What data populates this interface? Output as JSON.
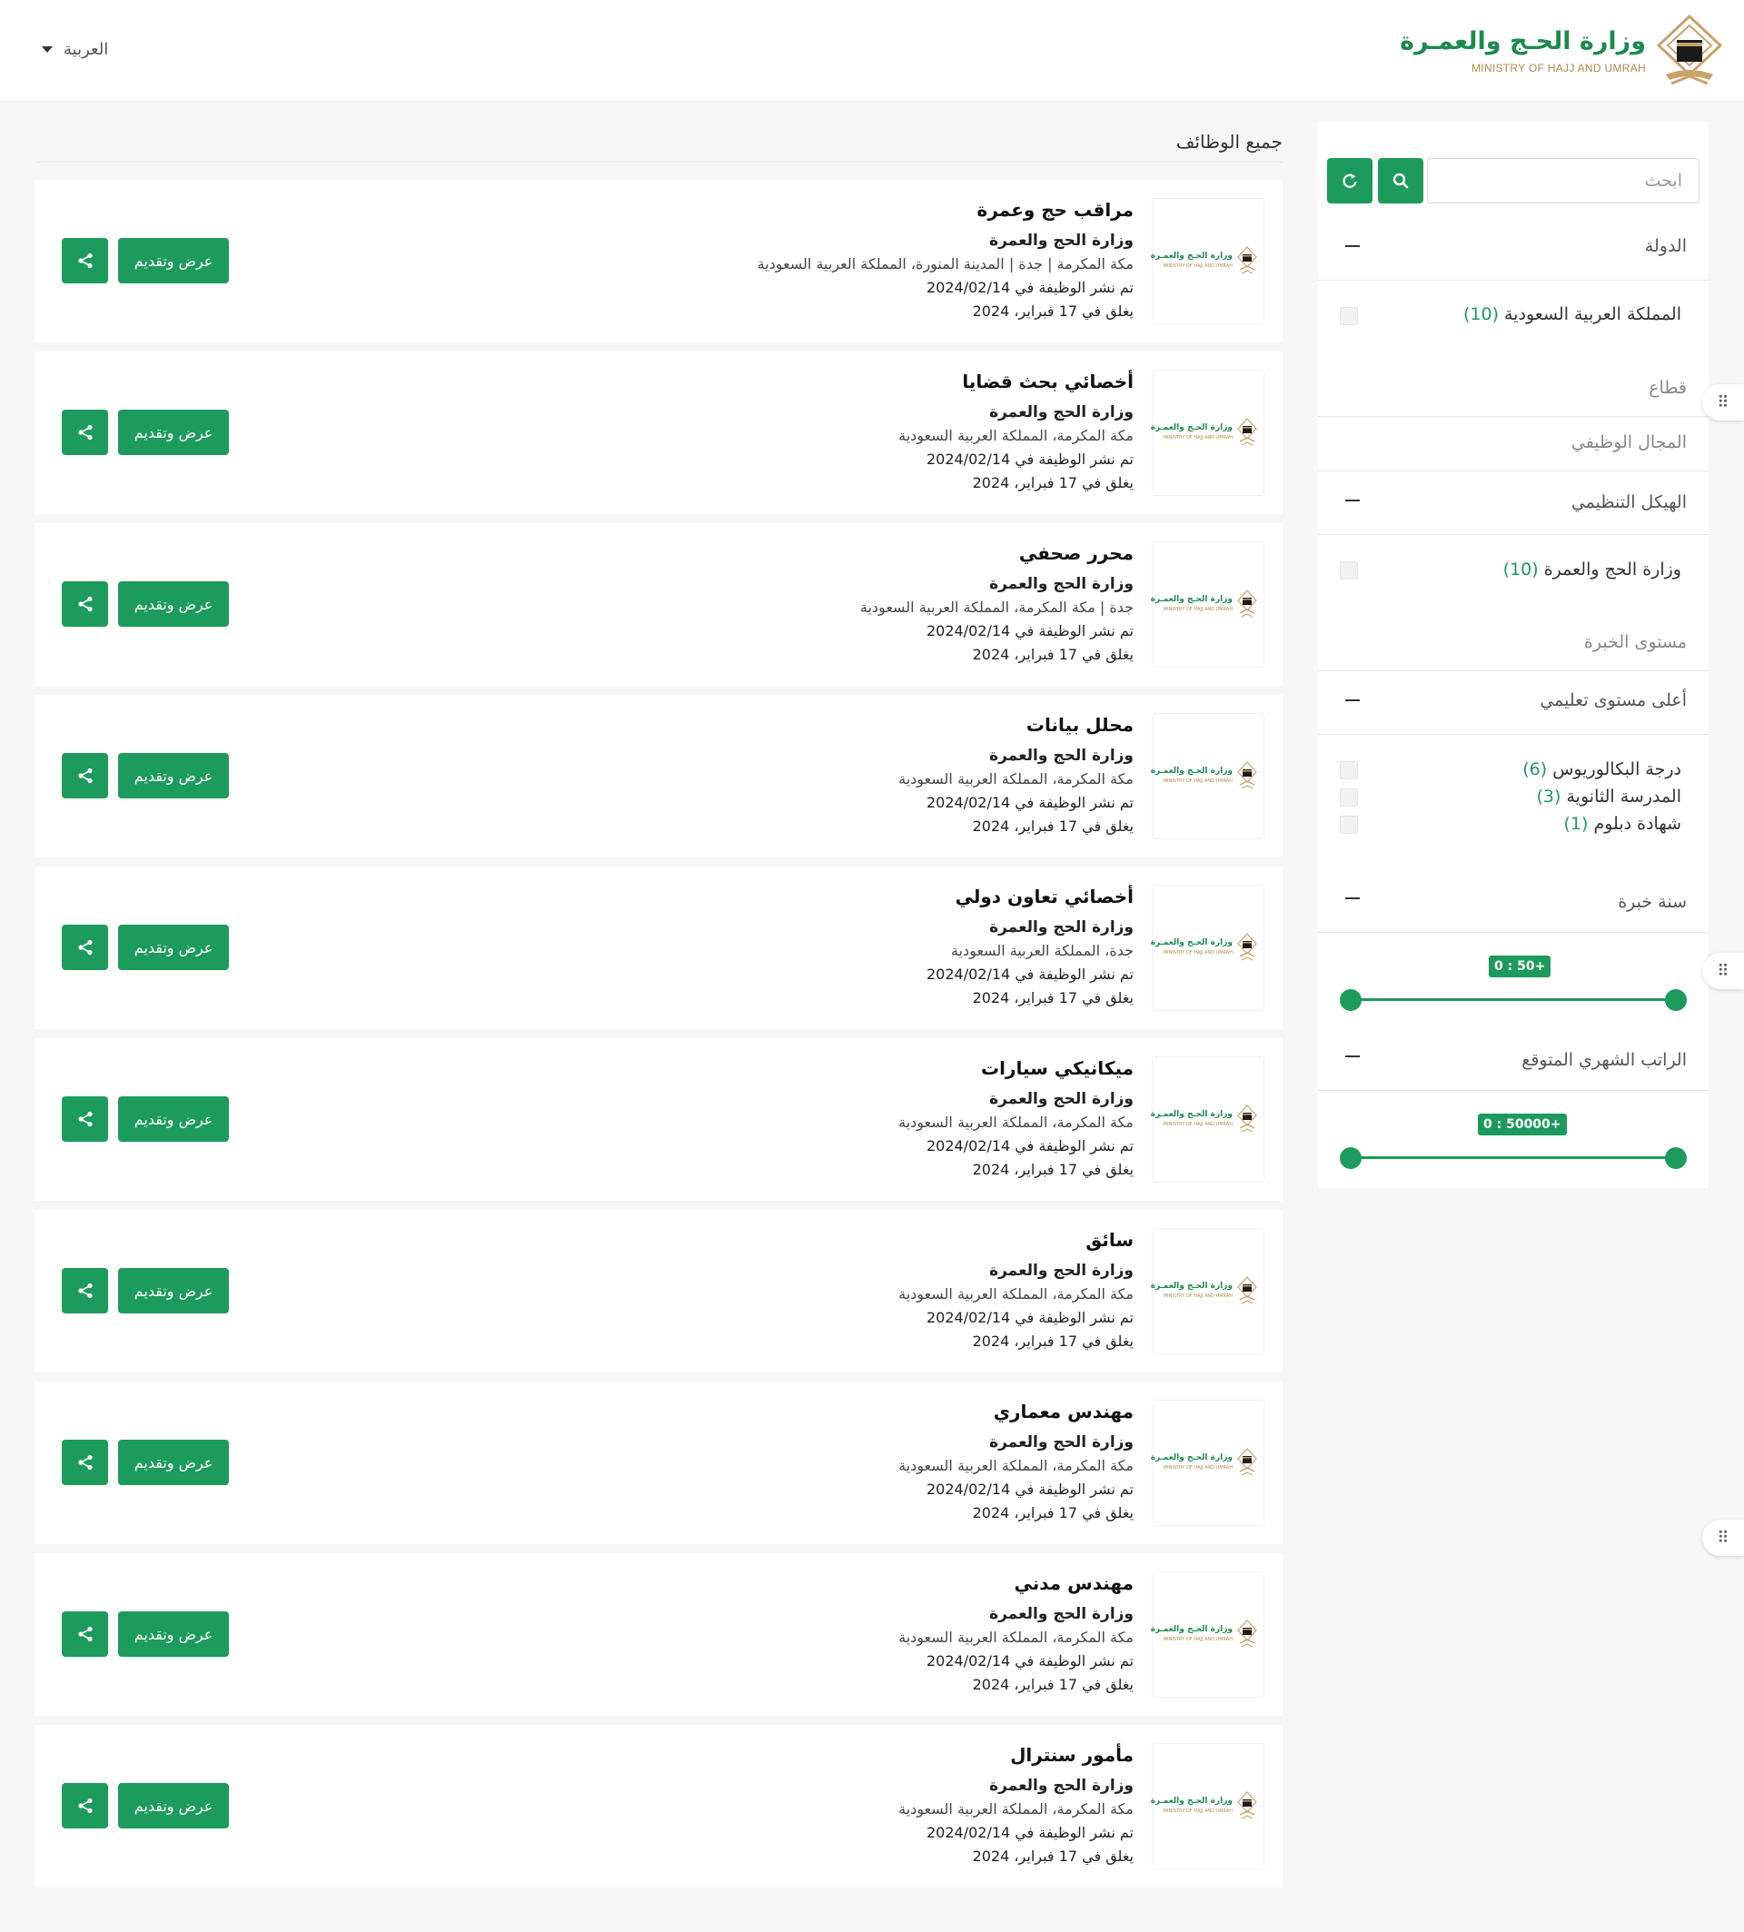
{
  "header": {
    "logo_ar": "وزارة الحـج والعمـرة",
    "logo_en": "MINISTRY OF HAJJ AND UMRAH",
    "language": "العربية"
  },
  "sidebar": {
    "search_placeholder": "ابحث",
    "filters": {
      "country": {
        "title": "الدولة",
        "options": [
          {
            "label": "المملكة العربية السعودية",
            "count": "(10)"
          }
        ]
      },
      "sector": {
        "title": "قطاع"
      },
      "job_field": {
        "title": "المجال الوظيفي"
      },
      "org_structure": {
        "title": "الهيكل التنظيمي",
        "options": [
          {
            "label": "وزارة الحج والعمرة",
            "count": "(10)"
          }
        ]
      },
      "experience_level": {
        "title": "مستوى الخبرة"
      },
      "education": {
        "title": "أعلى مستوى تعليمي",
        "options": [
          {
            "label": "درجة البكالوريوس",
            "count": "(6)"
          },
          {
            "label": "المدرسة الثانوية",
            "count": "(3)"
          },
          {
            "label": "شهادة دبلوم",
            "count": "(1)"
          }
        ]
      },
      "years_experience": {
        "title": "سنة خبرة",
        "range_label": "0 : 50+",
        "min": 0,
        "max": 50
      },
      "salary": {
        "title": "الراتب الشهري المتوقع",
        "range_label": "0 : 50000+",
        "min": 0,
        "max": 50000
      }
    }
  },
  "main": {
    "section_title": "جميع الوظائف",
    "apply_label": "عرض وتقديم",
    "jobs": [
      {
        "title": "مراقب حج وعمرة",
        "org": "وزارة الحج والعمرة",
        "location": "مكة المكرمة | جدة | المدينة المنورة، المملكة العربية السعودية",
        "posted": "تم نشر الوظيفة في 2024/02/14",
        "closes": "يغلق في 17 فبراير، 2024"
      },
      {
        "title": "أخصائي بحث قضايا",
        "org": "وزارة الحج والعمرة",
        "location": "مكة المكرمة، المملكة العربية السعودية",
        "posted": "تم نشر الوظيفة في 2024/02/14",
        "closes": "يغلق في 17 فبراير، 2024"
      },
      {
        "title": "محرر صحفي",
        "org": "وزارة الحج والعمرة",
        "location": "جدة | مكة المكرمة، المملكة العربية السعودية",
        "posted": "تم نشر الوظيفة في 2024/02/14",
        "closes": "يغلق في 17 فبراير، 2024"
      },
      {
        "title": "محلل بيانات",
        "org": "وزارة الحج والعمرة",
        "location": "مكة المكرمة، المملكة العربية السعودية",
        "posted": "تم نشر الوظيفة في 2024/02/14",
        "closes": "يغلق في 17 فبراير، 2024"
      },
      {
        "title": "أخصائي تعاون دولي",
        "org": "وزارة الحج والعمرة",
        "location": "جدة، المملكة العربية السعودية",
        "posted": "تم نشر الوظيفة في 2024/02/14",
        "closes": "يغلق في 17 فبراير، 2024"
      },
      {
        "title": "ميكانيكي سيارات",
        "org": "وزارة الحج والعمرة",
        "location": "مكة المكرمة، المملكة العربية السعودية",
        "posted": "تم نشر الوظيفة في 2024/02/14",
        "closes": "يغلق في 17 فبراير، 2024"
      },
      {
        "title": "سائق",
        "org": "وزارة الحج والعمرة",
        "location": "مكة المكرمة، المملكة العربية السعودية",
        "posted": "تم نشر الوظيفة في 2024/02/14",
        "closes": "يغلق في 17 فبراير، 2024"
      },
      {
        "title": "مهندس معماري",
        "org": "وزارة الحج والعمرة",
        "location": "مكة المكرمة، المملكة العربية السعودية",
        "posted": "تم نشر الوظيفة في 2024/02/14",
        "closes": "يغلق في 17 فبراير، 2024"
      },
      {
        "title": "مهندس مدني",
        "org": "وزارة الحج والعمرة",
        "location": "مكة المكرمة، المملكة العربية السعودية",
        "posted": "تم نشر الوظيفة في 2024/02/14",
        "closes": "يغلق في 17 فبراير، 2024"
      },
      {
        "title": "مأمور سنترال",
        "org": "وزارة الحج والعمرة",
        "location": "مكة المكرمة، المملكة العربية السعودية",
        "posted": "تم نشر الوظيفة في 2024/02/14",
        "closes": "يغلق في 17 فبراير، 2024"
      }
    ]
  },
  "colors": {
    "brand_green": "#1d9b5c",
    "logo_gold": "#b2894a"
  }
}
